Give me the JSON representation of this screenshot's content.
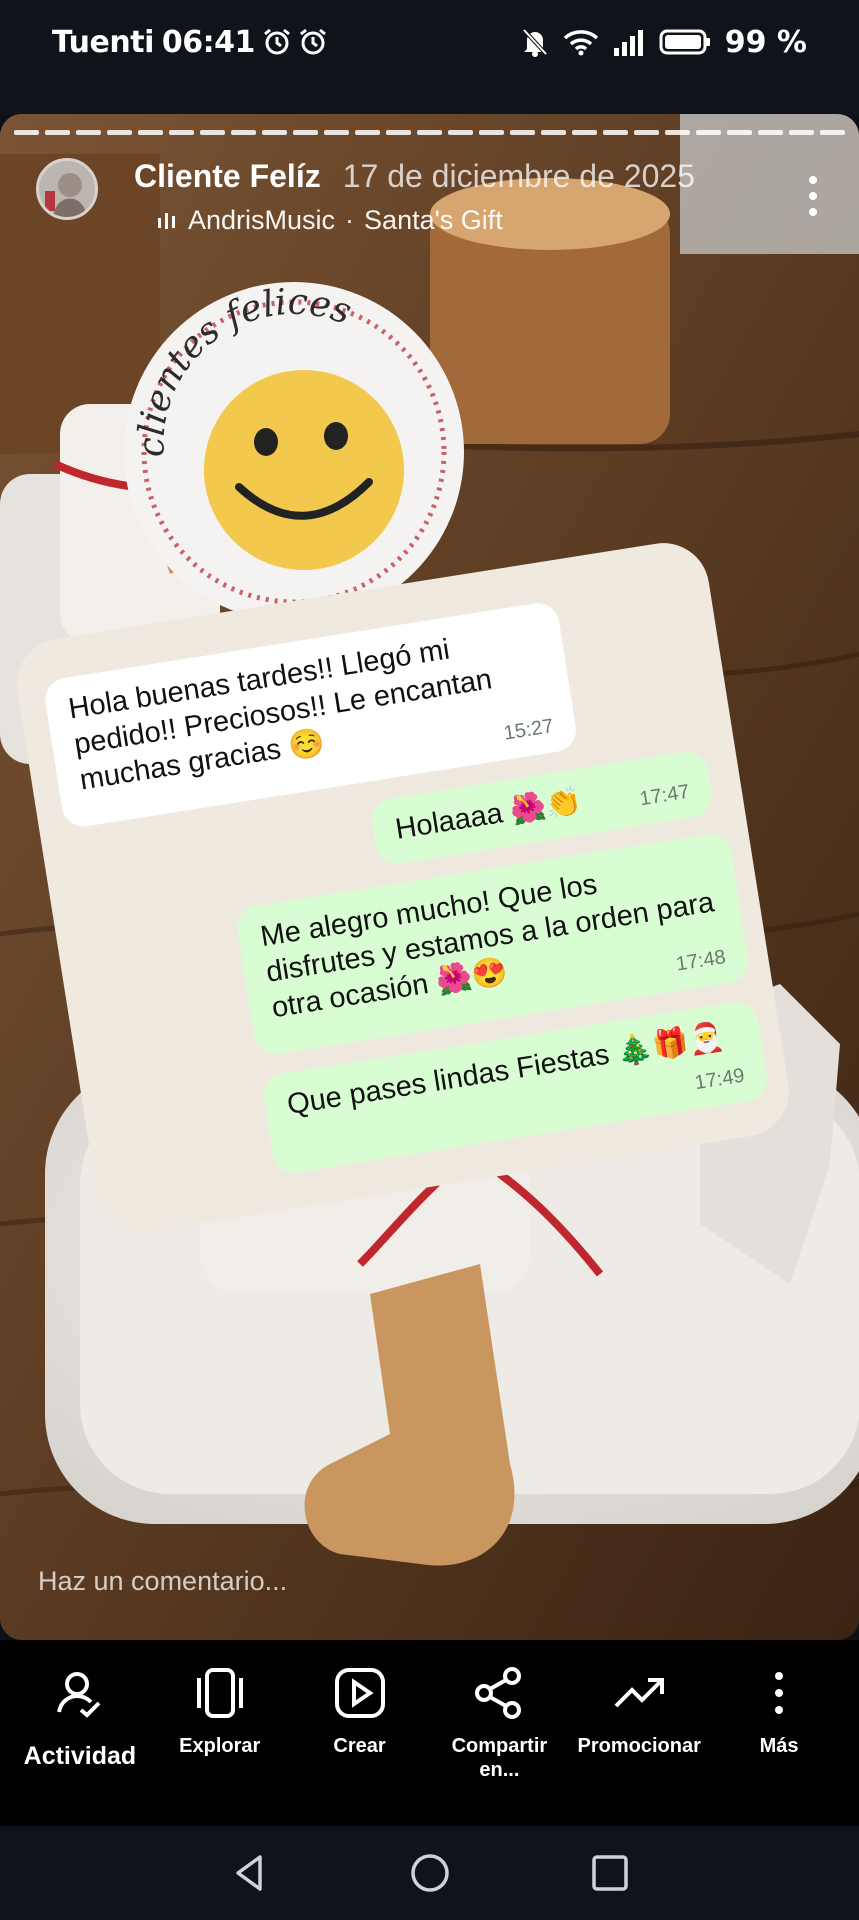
{
  "status_bar": {
    "carrier": "Tuenti",
    "time": "06:41",
    "battery": "99 %"
  },
  "story": {
    "author": "Cliente Felíz",
    "date": "17 de diciembre de 2025",
    "music_artist": "AndrisMusic",
    "music_separator": "·",
    "music_title": "Santa's Gift",
    "sticker_text": "clientes felices",
    "comment_placeholder": "Haz un comentario..."
  },
  "chat": {
    "messages": [
      {
        "direction": "in",
        "text": "Hola buenas tardes!! Llegó mi pedido!! Preciosos!! Le encantan muchas gracias ☺️",
        "time": "15:27"
      },
      {
        "direction": "out",
        "text": "Holaaaa 🌺👏",
        "time": "17:47"
      },
      {
        "direction": "out",
        "text": "Me alegro mucho! Que los disfrutes y estamos a la orden para otra ocasión 🌺😍",
        "time": "17:48"
      },
      {
        "direction": "out",
        "text": "Que pases lindas Fiestas 🎄🎁🎅",
        "time": "17:49"
      }
    ]
  },
  "bottom_nav": {
    "items": [
      {
        "label": "Actividad",
        "icon": "activity-icon"
      },
      {
        "label": "Explorar",
        "icon": "explore-icon"
      },
      {
        "label": "Crear",
        "icon": "create-icon"
      },
      {
        "label": "Compartir en...",
        "icon": "share-icon"
      },
      {
        "label": "Promocionar",
        "icon": "promote-icon"
      },
      {
        "label": "Más",
        "icon": "more-icon"
      }
    ]
  },
  "colors": {
    "bar_bg": "#0f131a",
    "nav_bg": "#000000",
    "bubble_out": "#d9fdd3",
    "bubble_in": "#ffffff",
    "smiley": "#f2c94c"
  }
}
